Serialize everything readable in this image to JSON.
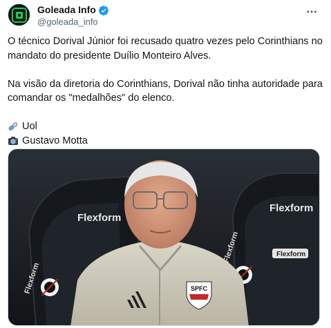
{
  "post": {
    "author": {
      "display_name": "Goleada Info",
      "handle": "@goleada_info",
      "verified": true,
      "avatar_icon": "goleada-logo-icon"
    },
    "more_icon": "more-options-icon",
    "text": {
      "paragraph1": "O técnico Dorival Júnior foi recusado quatro vezes pelo Corinthians no mandato do presidente Duílio Monteiro Alves.",
      "paragraph2": "Na visão da diretoria do Corinthians, Dorival não tinha autoridade para comandar os \"medalhões\" do elenco.",
      "source_label": "Uol",
      "source_icon": "link-icon",
      "photo_credit": "Gustavo Motta",
      "photo_credit_icon": "camera-icon"
    },
    "media": {
      "sponsor_text": "Flexform",
      "badge_text": "SPFC"
    }
  },
  "colors": {
    "verified": "#1d9bf0",
    "secondary_text": "#536471",
    "avatar_bg": "#0d1a12",
    "avatar_accent": "#22c55e"
  }
}
